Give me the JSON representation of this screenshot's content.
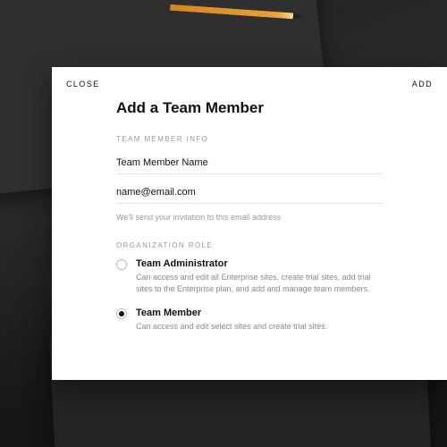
{
  "header": {
    "close_label": "CLOSE",
    "add_label": "ADD"
  },
  "title": "Add a Team Member",
  "sections": {
    "info_label": "TEAM MEMBER INFO",
    "role_label": "ORGANIZATION ROLE"
  },
  "fields": {
    "name_value": "Team Member Name",
    "email_value": "name@email.com"
  },
  "hint": "We'll send your invitation to this email address",
  "roles": [
    {
      "title": "Team Administrator",
      "desc": "Can access and edit all Enterprise sites, create trial sites, add trial sites to the Enterprise plan, and add and manage team members.",
      "selected": false
    },
    {
      "title": "Team Member",
      "desc": "Can access and edit select sites and create trial sites.",
      "selected": true
    }
  ]
}
